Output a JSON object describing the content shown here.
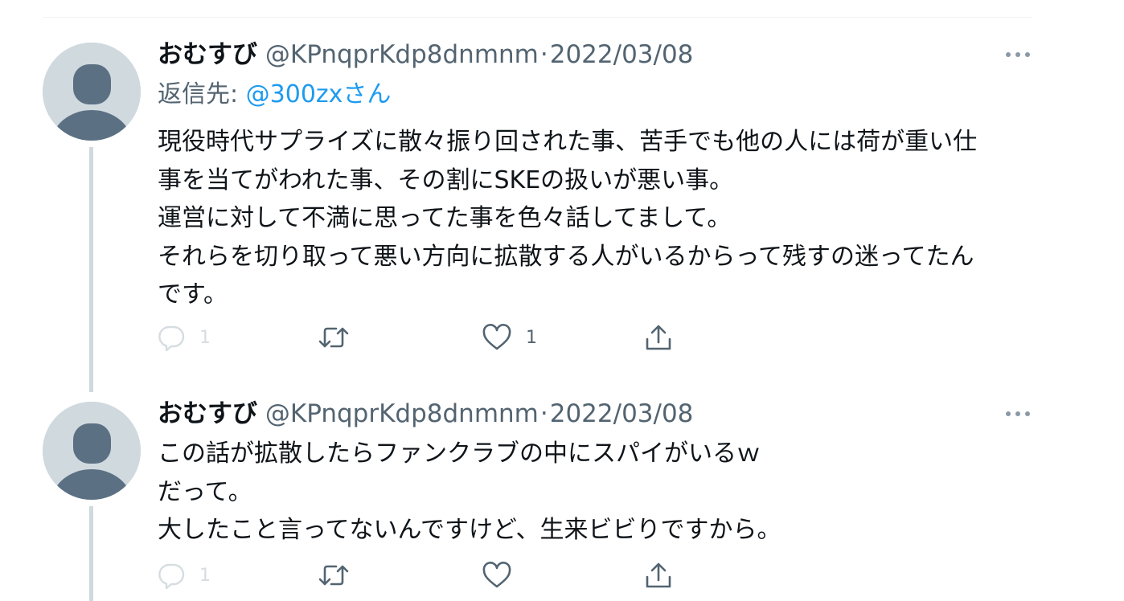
{
  "tweets": [
    {
      "display_name": "おむすび",
      "handle": "@KPnqprKdp8dnmnm",
      "separator": "·",
      "date": "2022/03/08",
      "reply_prefix": "返信先: ",
      "reply_mention": "@300zx",
      "reply_suffix": "さん",
      "lines": [
        "現役時代サプライズに散々振り回された事、苦手でも他の人には荷が重い仕",
        "事を当てがわれた事、その割にSKEの扱いが悪い事。",
        "運営に対して不満に思ってた事を色々話してまして。",
        "それらを切り取って悪い方向に拡散する人がいるからって残すの迷ってたん",
        "です。"
      ],
      "reply_count": "1",
      "like_count": "1"
    },
    {
      "display_name": "おむすび",
      "handle": "@KPnqprKdp8dnmnm",
      "separator": "·",
      "date": "2022/03/08",
      "lines": [
        "この話が拡散したらファンクラブの中にスパイがいるｗ",
        "だって。",
        "大したこと言ってないんですけど、生来ビビりですから。"
      ],
      "reply_count": "1"
    }
  ],
  "icons": {
    "avatar": "default-avatar-icon",
    "more": "more-horizontal-icon",
    "reply": "reply-icon",
    "retweet": "retweet-icon",
    "like": "heart-icon",
    "share": "share-icon"
  },
  "colors": {
    "text": "#0f1419",
    "secondary": "#536471",
    "link": "#1d9bf0",
    "avatar_bg": "#cfd9de",
    "avatar_fg": "#5b7083",
    "thread_line": "#cfd9de",
    "faded": "#d6dde1"
  }
}
